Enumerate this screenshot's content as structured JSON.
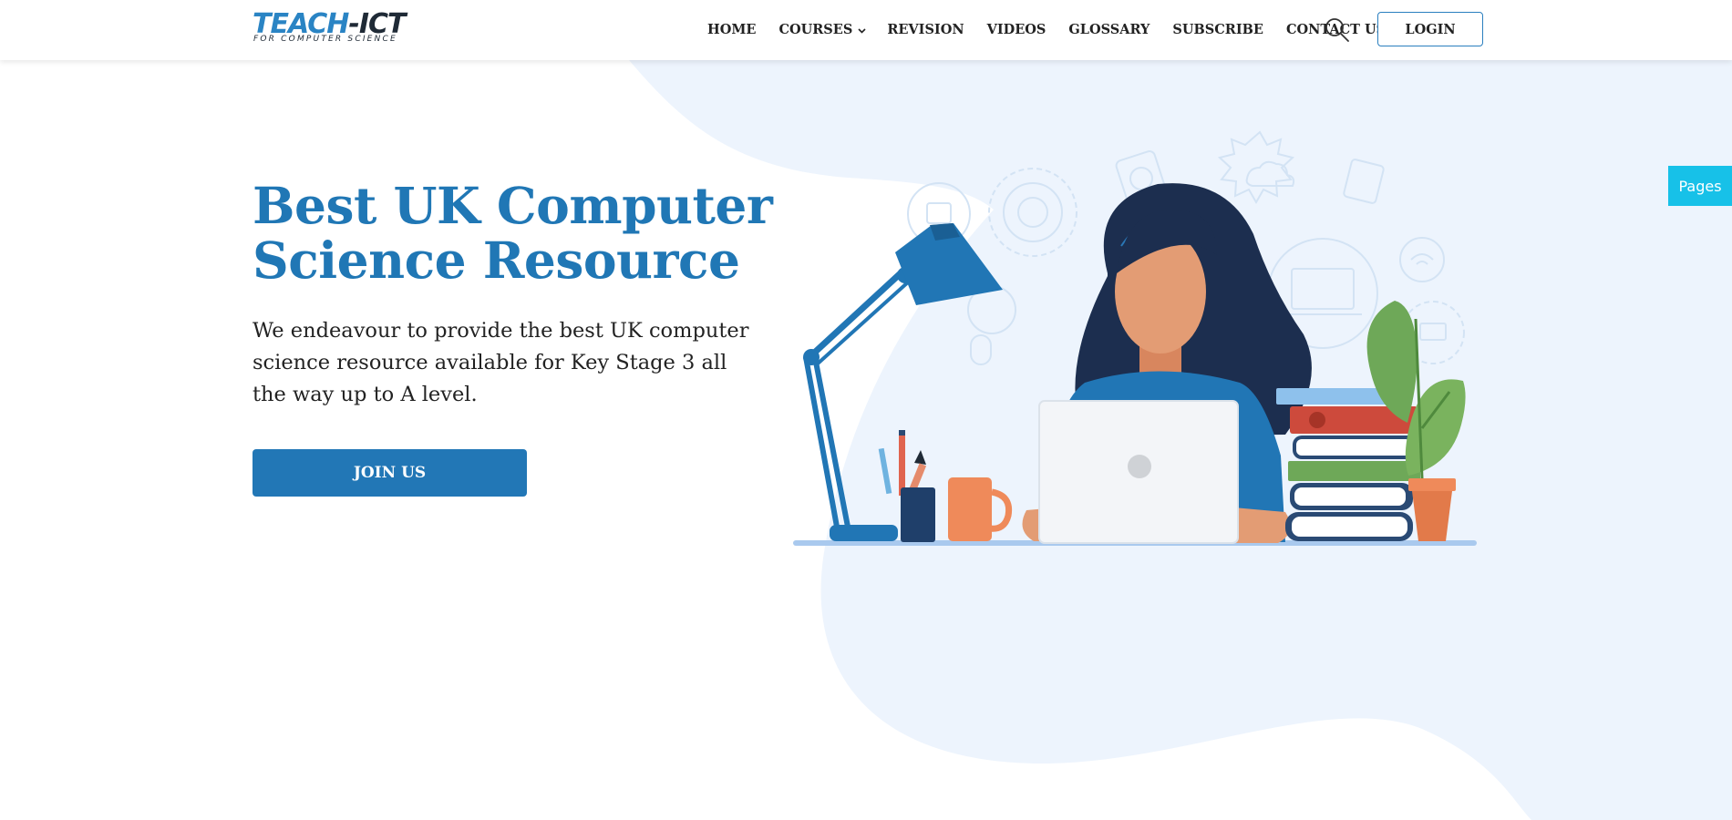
{
  "header": {
    "logo": {
      "main_part1": "TEACH",
      "main_part2": "-ICT",
      "tagline": "FOR COMPUTER SCIENCE"
    },
    "nav": [
      {
        "label": "HOME",
        "has_dropdown": false
      },
      {
        "label": "COURSES",
        "has_dropdown": true
      },
      {
        "label": "REVISION",
        "has_dropdown": false
      },
      {
        "label": "VIDEOS",
        "has_dropdown": false
      },
      {
        "label": "GLOSSARY",
        "has_dropdown": false
      },
      {
        "label": "SUBSCRIBE",
        "has_dropdown": false
      },
      {
        "label": "CONTACT US",
        "has_dropdown": false
      }
    ],
    "search_icon": "search-icon",
    "login_label": "LOGIN"
  },
  "hero": {
    "title": "Best UK Computer Science Resource",
    "description": "We endeavour to provide the best UK computer science resource available for Key Stage 3 all the way up to A level.",
    "cta_label": "JOIN US"
  },
  "side_tab": {
    "label": "Pages"
  },
  "colors": {
    "brand_blue": "#2077b5",
    "accent_cyan": "#17c1e8",
    "blob": "#ecf4fd",
    "text_dark": "#222222"
  }
}
